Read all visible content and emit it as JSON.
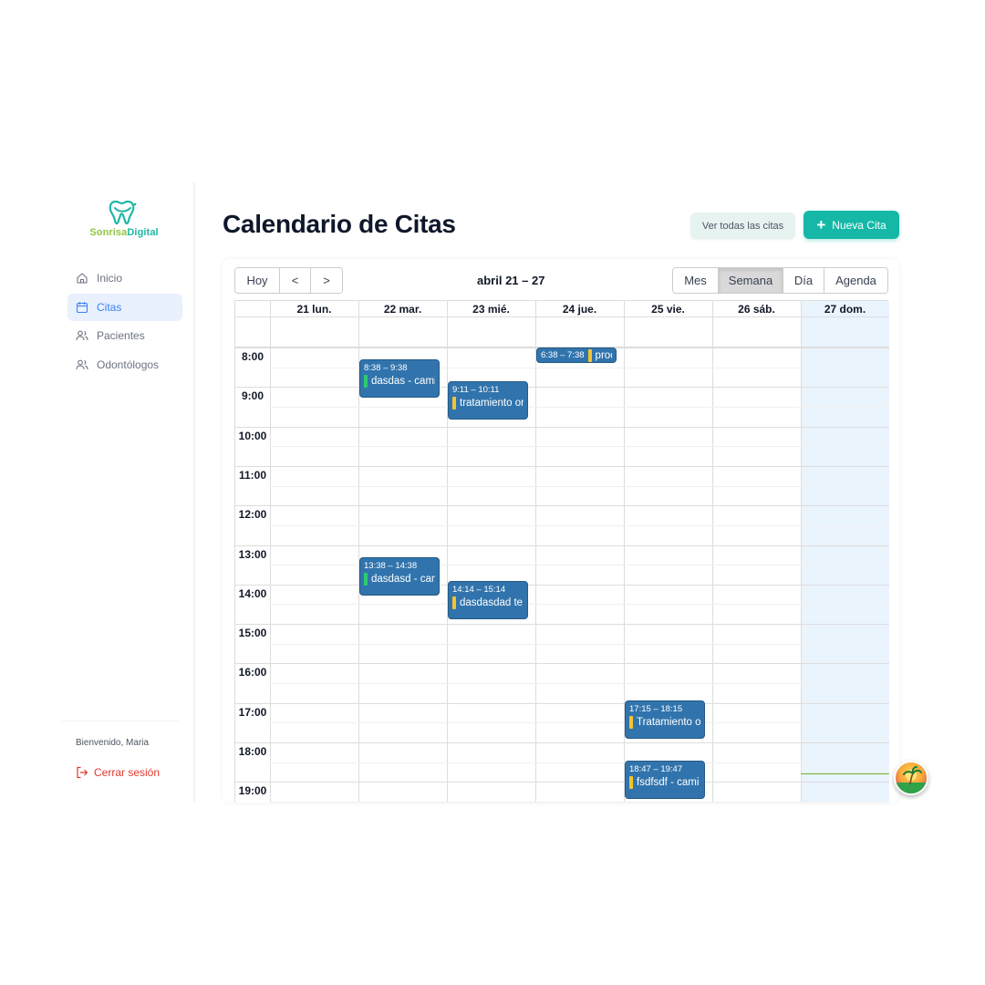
{
  "app": {
    "logo_part1": "Sonrisa",
    "logo_part2": "Digital",
    "brand_green": "#8dc63f",
    "brand_teal": "#1fb7a6"
  },
  "sidebar": {
    "items": [
      {
        "label": "Inicio",
        "icon": "home-icon",
        "active": false
      },
      {
        "label": "Citas",
        "icon": "calendar-icon",
        "active": true
      },
      {
        "label": "Pacientes",
        "icon": "users-icon",
        "active": false
      },
      {
        "label": "Odontólogos",
        "icon": "users-icon",
        "active": false
      }
    ],
    "welcome_prefix": "Bienvenido, ",
    "welcome_name": "Maria",
    "logout_label": "Cerrar sesión"
  },
  "header": {
    "title": "Calendario de Citas",
    "view_all_label": "Ver todas las citas",
    "new_label": "Nueva Cita",
    "accent": "#15b8a6"
  },
  "toolbar": {
    "today_label": "Hoy",
    "prev_label": "<",
    "next_label": ">",
    "range_label": "abril 21 – 27",
    "views": [
      "Mes",
      "Semana",
      "Día",
      "Agenda"
    ],
    "active_view": "Semana"
  },
  "calendar": {
    "days": [
      "21 lun.",
      "22 mar.",
      "23 mié.",
      "24 jue.",
      "25 vie.",
      "26 sáb.",
      "27 dom."
    ],
    "today_index": 6,
    "hours": [
      "8:00",
      "9:00",
      "10:00",
      "11:00",
      "12:00",
      "13:00",
      "14:00",
      "15:00",
      "16:00",
      "17:00",
      "18:00",
      "19:00"
    ],
    "current_time": "18:47",
    "event_color": "#3174ad",
    "events": [
      {
        "day": 3,
        "start": "6:38",
        "end": "7:38",
        "time": "6:38 – 7:38",
        "title": "proc",
        "bar": "#f4c430",
        "inline": true
      },
      {
        "day": 1,
        "start": "8:38",
        "end": "9:38",
        "time": "8:38 – 9:38",
        "title": "dasdas - cami",
        "bar": "#2ecc71"
      },
      {
        "day": 2,
        "start": "9:11",
        "end": "10:11",
        "time": "9:11 – 10:11",
        "title": "tratamiento or",
        "bar": "#f4c430"
      },
      {
        "day": 1,
        "start": "13:38",
        "end": "14:38",
        "time": "13:38 – 14:38",
        "title": "dasdasd - cam",
        "bar": "#2ecc71"
      },
      {
        "day": 2,
        "start": "14:14",
        "end": "15:14",
        "time": "14:14 – 15:14",
        "title": "dasdasdad te c",
        "bar": "#f4c430"
      },
      {
        "day": 4,
        "start": "17:15",
        "end": "18:15",
        "time": "17:15 – 18:15",
        "title": "Tratamiento or",
        "bar": "#f4c430"
      },
      {
        "day": 4,
        "start": "18:47",
        "end": "19:47",
        "time": "18:47 – 19:47",
        "title": "fsdfsdf - cami",
        "bar": "#f4c430"
      }
    ]
  }
}
